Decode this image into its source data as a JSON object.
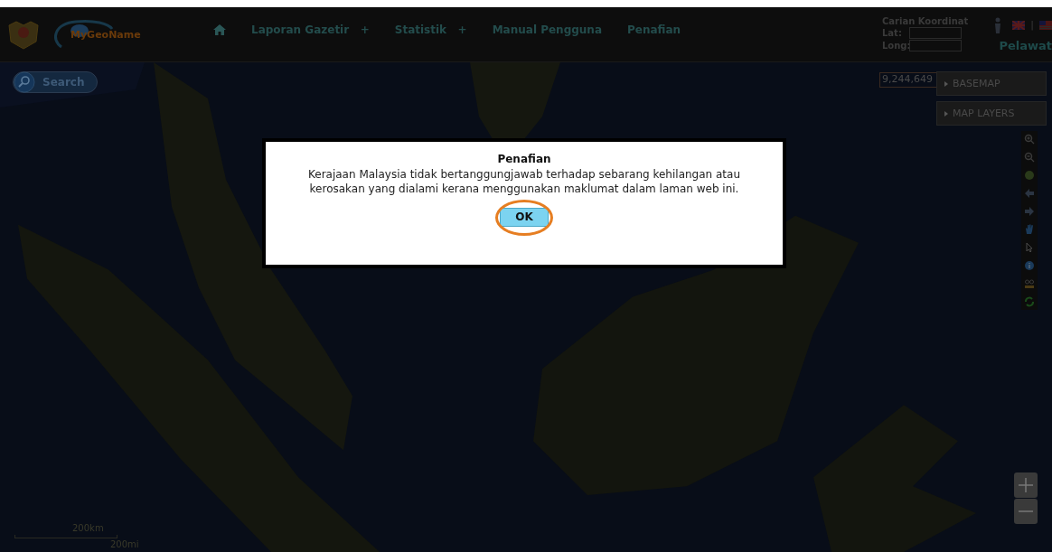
{
  "header": {
    "logo_text": "MyGeoName",
    "nav": [
      {
        "label": "Laporan Gazetir",
        "marker": "+"
      },
      {
        "label": "Statistik",
        "marker": "+"
      },
      {
        "label": "Manual Pengguna"
      },
      {
        "label": "Penafian"
      }
    ],
    "coordinate_search": {
      "title": "Carian Koordinat",
      "lat_label": "Lat:",
      "long_label": "Long:"
    },
    "language_separator": "|",
    "user": "Pelawat"
  },
  "map": {
    "search_button": "Search",
    "coordinate_readout": "9,244,649",
    "panel_buttons": [
      "BASEMAP",
      "MAP LAYERS"
    ],
    "scale": {
      "km": "200km",
      "mi": "200mi"
    }
  },
  "dialog": {
    "title": "Penafian",
    "message": "Kerajaan Malaysia tidak bertanggungjawab terhadap sebarang kehilangan atau kerosakan yang dialami kerana menggunakan maklumat dalam laman web ini.",
    "button": "OK",
    "highlighted": true
  }
}
